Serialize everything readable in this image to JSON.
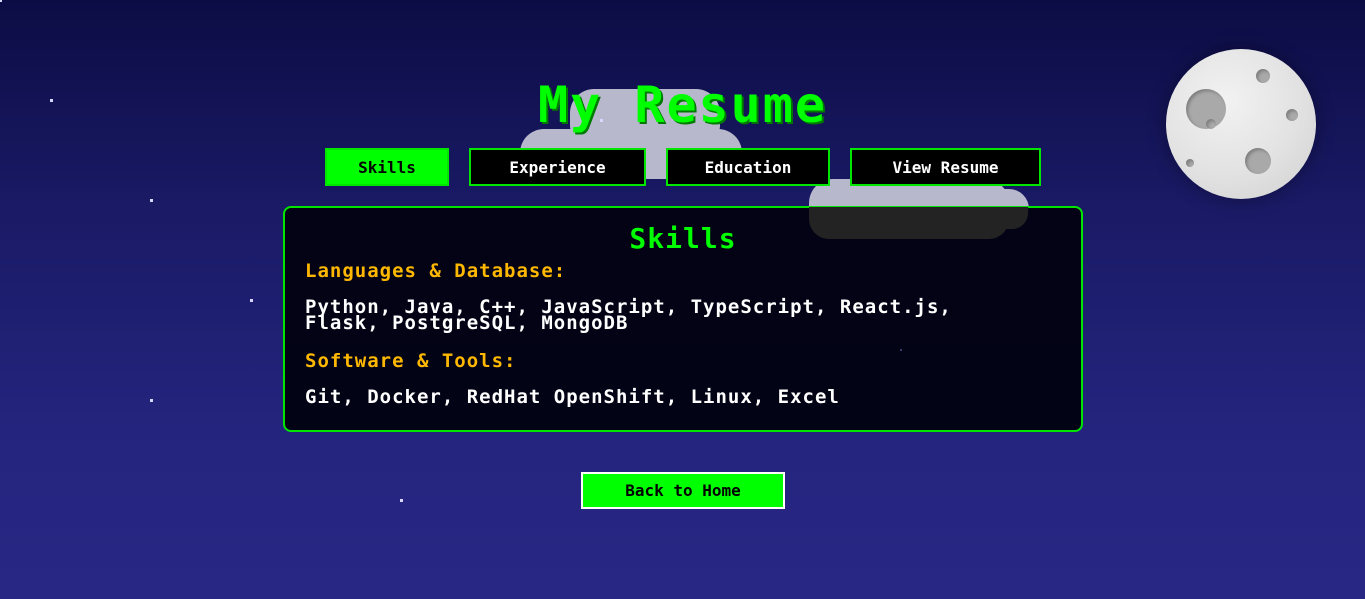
{
  "page": {
    "title": "My Resume"
  },
  "tabs": [
    {
      "label": "Skills",
      "active": true
    },
    {
      "label": "Experience",
      "active": false
    },
    {
      "label": "Education",
      "active": false
    },
    {
      "label": "View Resume",
      "active": false
    }
  ],
  "panel": {
    "title": "Skills",
    "sections": [
      {
        "heading": "Languages & Database:",
        "body": "Python, Java, C++, JavaScript, TypeScript, React.js, Flask, PostgreSQL, MongoDB"
      },
      {
        "heading": "Software & Tools:",
        "body": "Git, Docker, RedHat OpenShift, Linux, Excel"
      }
    ]
  },
  "back_button": {
    "label": "Back to Home"
  },
  "colors": {
    "accent": "#00ff00",
    "heading": "#ffb800",
    "panel_bg": "#020212",
    "sky_top": "#0c0c45",
    "sky_bottom": "#282884",
    "moon": "#e2e2e2"
  },
  "icons": {
    "moon": "moon-icon",
    "cloud": "cloud-icon",
    "star": "star-icon"
  }
}
